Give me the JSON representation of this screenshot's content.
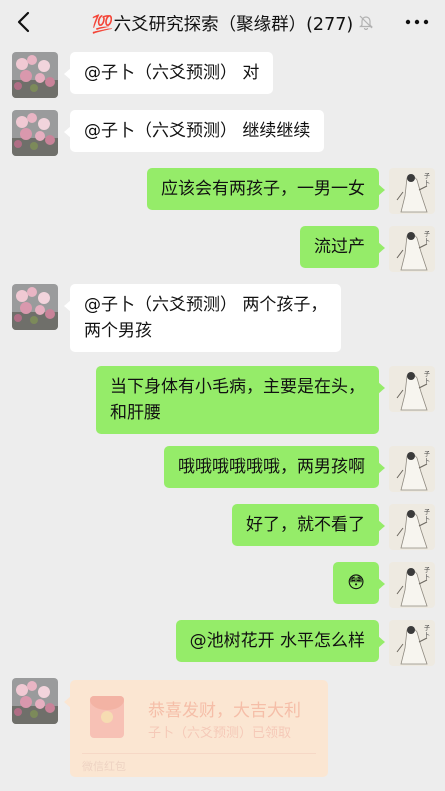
{
  "header": {
    "title": "💯六爻研究探索（聚缘群）(277)"
  },
  "messages": [
    {
      "side": "in",
      "lines": [
        "@子卜（六爻预测）  对"
      ]
    },
    {
      "side": "in",
      "lines": [
        "@子卜（六爻预测）  继续继续"
      ]
    },
    {
      "side": "out",
      "lines": [
        "应该会有两孩子，一男一女"
      ]
    },
    {
      "side": "out",
      "lines": [
        "流过产"
      ]
    },
    {
      "side": "in",
      "lines": [
        "@子卜（六爻预测）  两个孩子，",
        "两个男孩"
      ]
    },
    {
      "side": "out",
      "lines": [
        "当下身体有小毛病，主要是在头，",
        "和肝腰"
      ]
    },
    {
      "side": "out",
      "lines": [
        "哦哦哦哦哦哦，两男孩啊"
      ]
    },
    {
      "side": "out",
      "lines": [
        "好了，就不看了"
      ]
    },
    {
      "side": "out",
      "lines": [
        "😳"
      ]
    },
    {
      "side": "out",
      "lines": [
        "@池树花开  水平怎么样"
      ]
    }
  ],
  "red_packet": {
    "title": "恭喜发财，大吉大利",
    "status": "子卜（六爻预测）已领取",
    "footer": "微信红包"
  }
}
